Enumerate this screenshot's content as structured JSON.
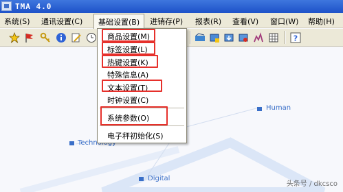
{
  "window": {
    "title": "TMA 4.0"
  },
  "menubar": {
    "items": [
      "系统(S)",
      "通讯设置(C)",
      "基础设置(B)",
      "进销存(P)",
      "报表(R)",
      "查看(V)",
      "窗口(W)",
      "帮助(H)"
    ]
  },
  "dropdown": {
    "items": [
      "商品设置(M)",
      "标签设置(L)",
      "热键设置(K)",
      "特殊信息(A)",
      "文本设置(T)",
      "时钟设置(C)",
      "系统参数(O)",
      "电子秤初始化(S)"
    ]
  },
  "background": {
    "labels": [
      "Human",
      "Technology",
      "Digital"
    ]
  },
  "watermark": "头条号 / dkcsco",
  "colors": {
    "titlebar": "#1d52c8",
    "highlight_box": "#e6302b",
    "graph": "#3a6fc8"
  }
}
